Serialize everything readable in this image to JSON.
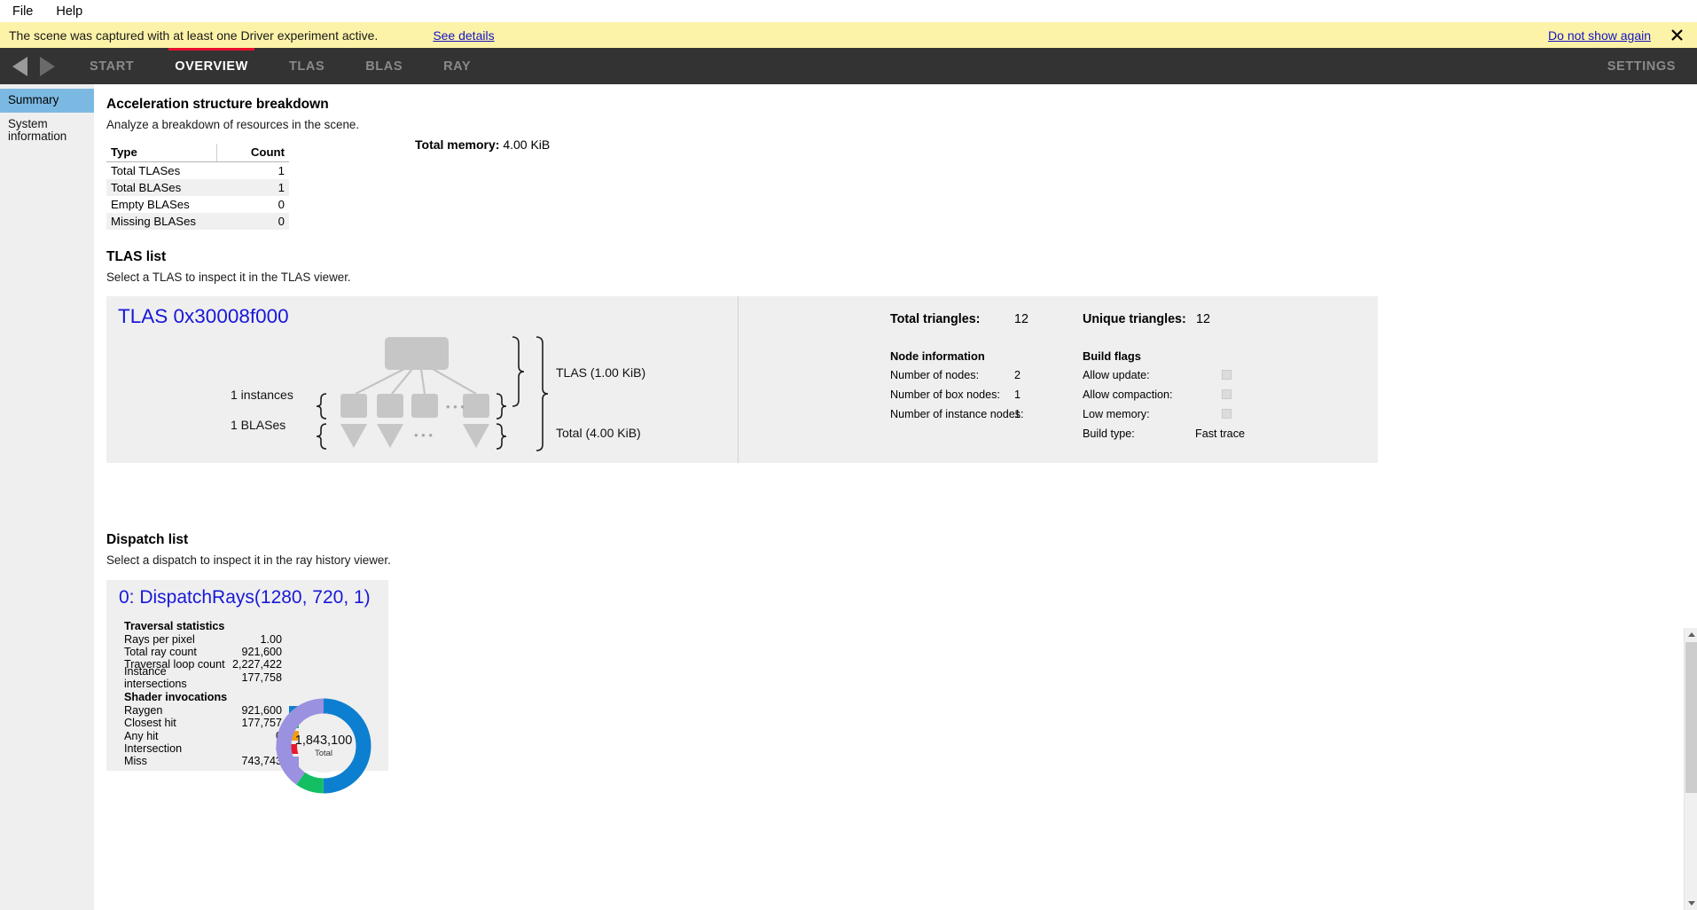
{
  "menubar": {
    "items": [
      {
        "label": "File"
      },
      {
        "label": "Help"
      }
    ]
  },
  "banner": {
    "message": "The scene was captured with at least one Driver experiment active.",
    "see_details": "See details",
    "do_not_show_again": "Do not show again",
    "close_icon": "close-icon",
    "bg_color": "#fdf3a8"
  },
  "nav": {
    "back_icon": "arrow-left-icon",
    "forward_icon": "arrow-right-icon",
    "tabs": [
      {
        "label": "START",
        "active": false
      },
      {
        "label": "OVERVIEW",
        "active": true
      },
      {
        "label": "TLAS",
        "active": false
      },
      {
        "label": "BLAS",
        "active": false
      },
      {
        "label": "RAY",
        "active": false
      }
    ],
    "settings_label": "SETTINGS",
    "accent_color": "#e8112d",
    "bg_color": "#333333"
  },
  "sidebar": {
    "items": [
      {
        "label": "Summary",
        "active": true
      },
      {
        "label": "System information",
        "active": false
      }
    ],
    "active_color": "#7cb9e2"
  },
  "breakdown": {
    "title": "Acceleration structure breakdown",
    "subtitle": "Analyze a breakdown of resources in the scene.",
    "columns": [
      "Type",
      "Count"
    ],
    "rows": [
      {
        "type": "Total TLASes",
        "count": "1"
      },
      {
        "type": "Total BLASes",
        "count": "1"
      },
      {
        "type": "Empty BLASes",
        "count": "0"
      },
      {
        "type": "Missing BLASes",
        "count": "0"
      }
    ],
    "total_memory_label": "Total memory:",
    "total_memory_value": "4.00 KiB"
  },
  "tlas_list": {
    "title": "TLAS list",
    "subtitle": "Select a TLAS to inspect it in the TLAS viewer.",
    "card": {
      "title": "TLAS 0x30008f000",
      "diagram": {
        "instances_label": "1 instances",
        "blases_label": "1 BLASes",
        "tlas_size_label": "TLAS (1.00 KiB)",
        "total_size_label": "Total (4.00 KiB)",
        "ellipsis": "• • •"
      },
      "total_triangles_label": "Total triangles:",
      "total_triangles_value": "12",
      "unique_triangles_label": "Unique triangles:",
      "unique_triangles_value": "12",
      "node_information_header": "Node information",
      "node_rows": [
        {
          "label": "Number of nodes:",
          "value": "2"
        },
        {
          "label": "Number of box nodes:",
          "value": "1"
        },
        {
          "label": "Number of instance nodes:",
          "value": "1"
        }
      ],
      "build_flags_header": "Build flags",
      "flag_rows": [
        {
          "label": "Allow update:",
          "checked": false
        },
        {
          "label": "Allow compaction:",
          "checked": false
        },
        {
          "label": "Low memory:",
          "checked": false
        }
      ],
      "build_type_label": "Build type:",
      "build_type_value": "Fast trace"
    }
  },
  "dispatch_list": {
    "title": "Dispatch list",
    "subtitle": "Select a dispatch to inspect it in the ray history viewer.",
    "card": {
      "title": "0: DispatchRays(1280, 720, 1)",
      "traversal_header": "Traversal statistics",
      "traversal_rows": [
        {
          "label": "Rays per pixel",
          "value": "1.00"
        },
        {
          "label": "Total ray count",
          "value": "921,600"
        },
        {
          "label": "Traversal loop count",
          "value": "2,227,422"
        },
        {
          "label": "Instance intersections",
          "value": "177,758"
        }
      ],
      "shader_header": "Shader invocations",
      "shader_rows": [
        {
          "label": "Raygen",
          "value": "921,600",
          "color": "#0d7fd0"
        },
        {
          "label": "Closest hit",
          "value": "177,757",
          "color": "#13bf62"
        },
        {
          "label": "Any hit",
          "value": "0",
          "color": "#f59b12"
        },
        {
          "label": "Intersection",
          "value": "0",
          "color": "#e8192c"
        },
        {
          "label": "Miss",
          "value": "743,743",
          "color": "#9a91e0"
        }
      ],
      "donut_total": "1,843,100",
      "donut_label": "Total"
    }
  },
  "chart_data": {
    "type": "pie",
    "title": "Shader invocations",
    "categories": [
      "Raygen",
      "Closest hit",
      "Any hit",
      "Intersection",
      "Miss"
    ],
    "values": [
      921600,
      177757,
      0,
      0,
      743743
    ],
    "colors": [
      "#0d7fd0",
      "#13bf62",
      "#f59b12",
      "#e8192c",
      "#9a91e0"
    ],
    "total": 1843100,
    "center_label": "Total",
    "legend": "inline-left"
  },
  "scrollbar": {
    "up_icon": "chevron-up-icon",
    "down_icon": "chevron-down-icon"
  }
}
